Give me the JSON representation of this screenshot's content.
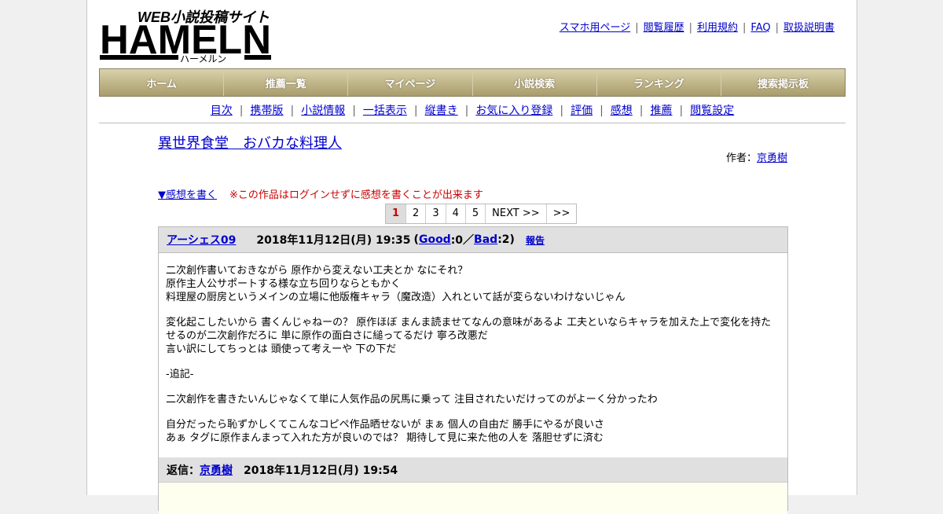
{
  "brand": {
    "logo_tagline": "WEB小説投稿サイト",
    "logo_name": "HAMELN",
    "logo_kana": "ハーメルン"
  },
  "toplinks": [
    "スマホ用ページ",
    "閲覧履歴",
    "利用規約",
    "FAQ",
    "取扱説明書"
  ],
  "nav": [
    "ホーム",
    "推薦一覧",
    "マイページ",
    "小説検索",
    "ランキング",
    "捜索掲示板"
  ],
  "subnav": [
    "目次",
    "携帯版",
    "小説情報",
    "一括表示",
    "縦書き",
    "お気に入り登録",
    "評価",
    "感想",
    "推薦",
    "閲覧設定"
  ],
  "novel": {
    "title": "異世界食堂　おバカな料理人",
    "author_label": "作者：",
    "author": "京勇樹"
  },
  "write": {
    "link": "▼感想を書く",
    "note": "※この作品はログインせずに感想を書くことが出来ます"
  },
  "pager": [
    "1",
    "2",
    "3",
    "4",
    "5",
    "NEXT >>",
    ">>"
  ],
  "review": {
    "user": "アーシェス09",
    "date": "2018年11月12日(月) 19:35",
    "open": "(",
    "good": "Good",
    "good_count": ":0／",
    "bad": "Bad",
    "bad_count": ":2)",
    "report": "報告",
    "paragraphs": [
      "二次創作書いておきながら 原作から変えない工夫とか なにそれ？\n原作主人公サポートする様な立ち回りならともかく\n料理屋の厨房というメインの立場に他版権キャラ（魔改造）入れといて話が変らないわけないじゃん",
      "変化起こしたいから 書くんじゃねーの？ 原作ほぼ まんま読ませてなんの意味があるよ 工夫といならキャラを加えた上で変化を持たせるのが二次創作だろに 単に原作の面白さに縋ってるだけ 寧ろ改悪だ\n言い訳にしてちっとは 頭使って考えーや 下の下だ",
      "-追記-",
      "二次創作を書きたいんじゃなくて単に人気作品の尻馬に乗って 注目されたいだけってのがよーく分かったわ",
      "自分だったら恥ずかしくてこんなコピペ作品晒せないが まぁ 個人の自由だ 勝手にやるが良いさ\nあぁ タグに原作まんまって入れた方が良いのでは？ 期待して見に来た他の人を 落胆せずに済む"
    ]
  },
  "reply": {
    "label": "返信：",
    "user": "京勇樹",
    "date": "2018年11月12日(月) 19:54"
  }
}
